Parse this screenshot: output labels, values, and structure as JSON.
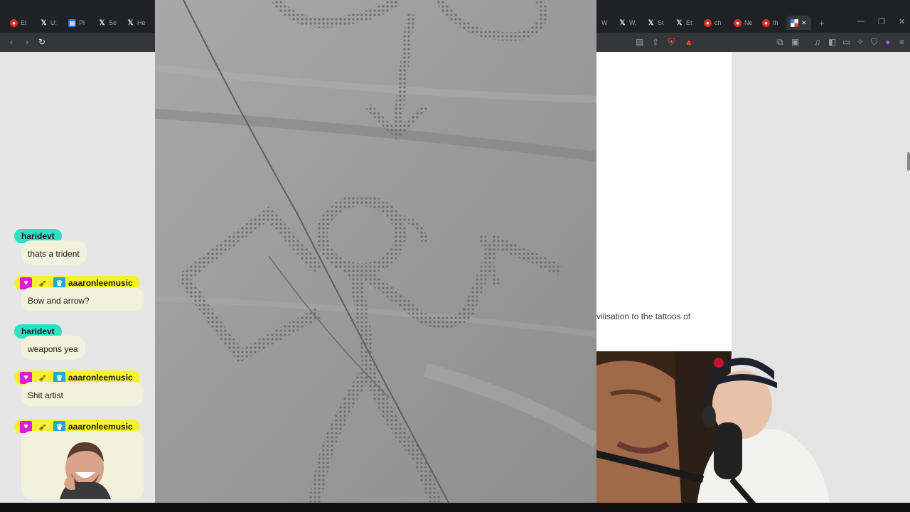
{
  "browser": {
    "tabs": [
      {
        "icon": "red-circle",
        "label": "Et"
      },
      {
        "icon": "x-logo",
        "label": "U:"
      },
      {
        "icon": "blue-square",
        "label": "Pł"
      },
      {
        "icon": "x-logo",
        "label": "Se"
      },
      {
        "icon": "x-logo",
        "label": "He"
      }
    ],
    "tabs_right": [
      {
        "icon": "blank",
        "label": "W"
      },
      {
        "icon": "x-logo",
        "label": "W."
      },
      {
        "icon": "x-logo",
        "label": "St"
      },
      {
        "icon": "x-logo",
        "label": "Et"
      },
      {
        "icon": "red-circle",
        "label": "ch"
      },
      {
        "icon": "red-circle",
        "label": "Ne"
      },
      {
        "icon": "red-circle",
        "label": "th"
      }
    ],
    "new_tab_glyph": "+",
    "close_glyph": "✕"
  },
  "article": {
    "visible_text": "vilisation to the tattoos of"
  },
  "chat": {
    "messages": [
      {
        "user": "haridevt",
        "color": "teal",
        "badges": false,
        "text": "thats a trident"
      },
      {
        "user": "aaaronleemusic",
        "color": "yellow",
        "badges": true,
        "text": "Bow and arrow?"
      },
      {
        "user": "haridevt",
        "color": "teal",
        "badges": false,
        "text": "weapons yea"
      },
      {
        "user": "aaaronleemusic",
        "color": "yellow",
        "badges": true,
        "text": "Shit artist"
      },
      {
        "user": "aaaronleemusic",
        "color": "yellow",
        "badges": true,
        "text": ""
      }
    ]
  },
  "colors": {
    "teal_pill": "#2de0c4",
    "yellow_pill": "#f7f12c",
    "bubble": "#f2f1dc",
    "rock": "#9c9c9c"
  },
  "icons": [
    "back-icon",
    "forward-icon",
    "reload-icon",
    "reader-icon",
    "share-icon",
    "brave-shield-icon",
    "brave-rewards-icon",
    "extensions-icon",
    "screenshot-icon",
    "music-icon",
    "sidebar-icon",
    "wallet-icon",
    "leo-icon",
    "vpn-icon",
    "menu-icon"
  ]
}
